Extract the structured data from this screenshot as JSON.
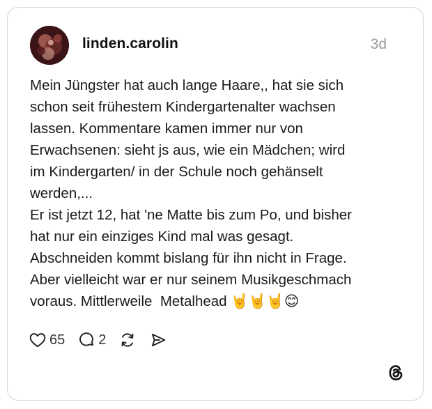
{
  "post": {
    "username": "linden.carolin",
    "timestamp": "3d",
    "text": "Mein Jüngster hat auch lange Haare,, hat sie sich\nschon seit frühestem Kindergartenalter wachsen\nlassen. Kommentare kamen immer nur von\nErwachsenen: sieht js aus, wie ein Mädchen; wird\nim Kindergarten/ in der Schule noch gehänselt\nwerden,...\nEr ist jetzt 12, hat 'ne Matte bis zum Po, und bisher\nhat nur ein einziges Kind mal was gesagt.\nAbschneiden kommt bislang für ihn nicht in Frage.\nAber vielleicht war er nur seinem Musikgeschmach\nvoraus. Mittlerweile  Metalhead 🤘🤘🤘😊"
  },
  "actions": {
    "likes": "65",
    "replies": "2",
    "like_icon": "heart-icon",
    "reply_icon": "speech-bubble-icon",
    "repost_icon": "repost-icon",
    "share_icon": "send-icon"
  },
  "branding": {
    "logo_icon": "threads-logo-icon"
  }
}
